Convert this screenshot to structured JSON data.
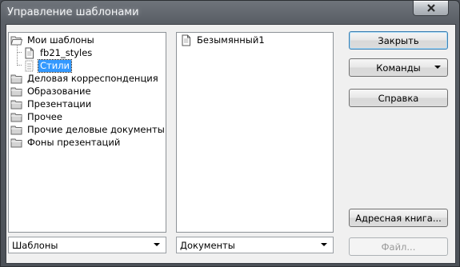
{
  "window": {
    "title": "Управление шаблонами"
  },
  "left_tree": [
    {
      "label": "Мои шаблоны",
      "type": "folder-open"
    },
    {
      "label": "fb21_styles",
      "type": "document"
    },
    {
      "label": "Стили",
      "type": "style-doc",
      "selected": true
    },
    {
      "label": "Деловая корреспонденция",
      "type": "folder"
    },
    {
      "label": "Образование",
      "type": "folder"
    },
    {
      "label": "Презентации",
      "type": "folder"
    },
    {
      "label": "Прочее",
      "type": "folder"
    },
    {
      "label": "Прочие деловые документы",
      "type": "folder"
    },
    {
      "label": "Фоны презентаций",
      "type": "folder"
    }
  ],
  "mid_list": [
    {
      "label": "Безымянный1",
      "type": "document"
    }
  ],
  "buttons": {
    "close": "Закрыть",
    "commands": "Команды",
    "help": "Справка",
    "address_book": "Адресная книга...",
    "file": "Файл..."
  },
  "combos": {
    "left": "Шаблоны",
    "mid": "Документы"
  }
}
